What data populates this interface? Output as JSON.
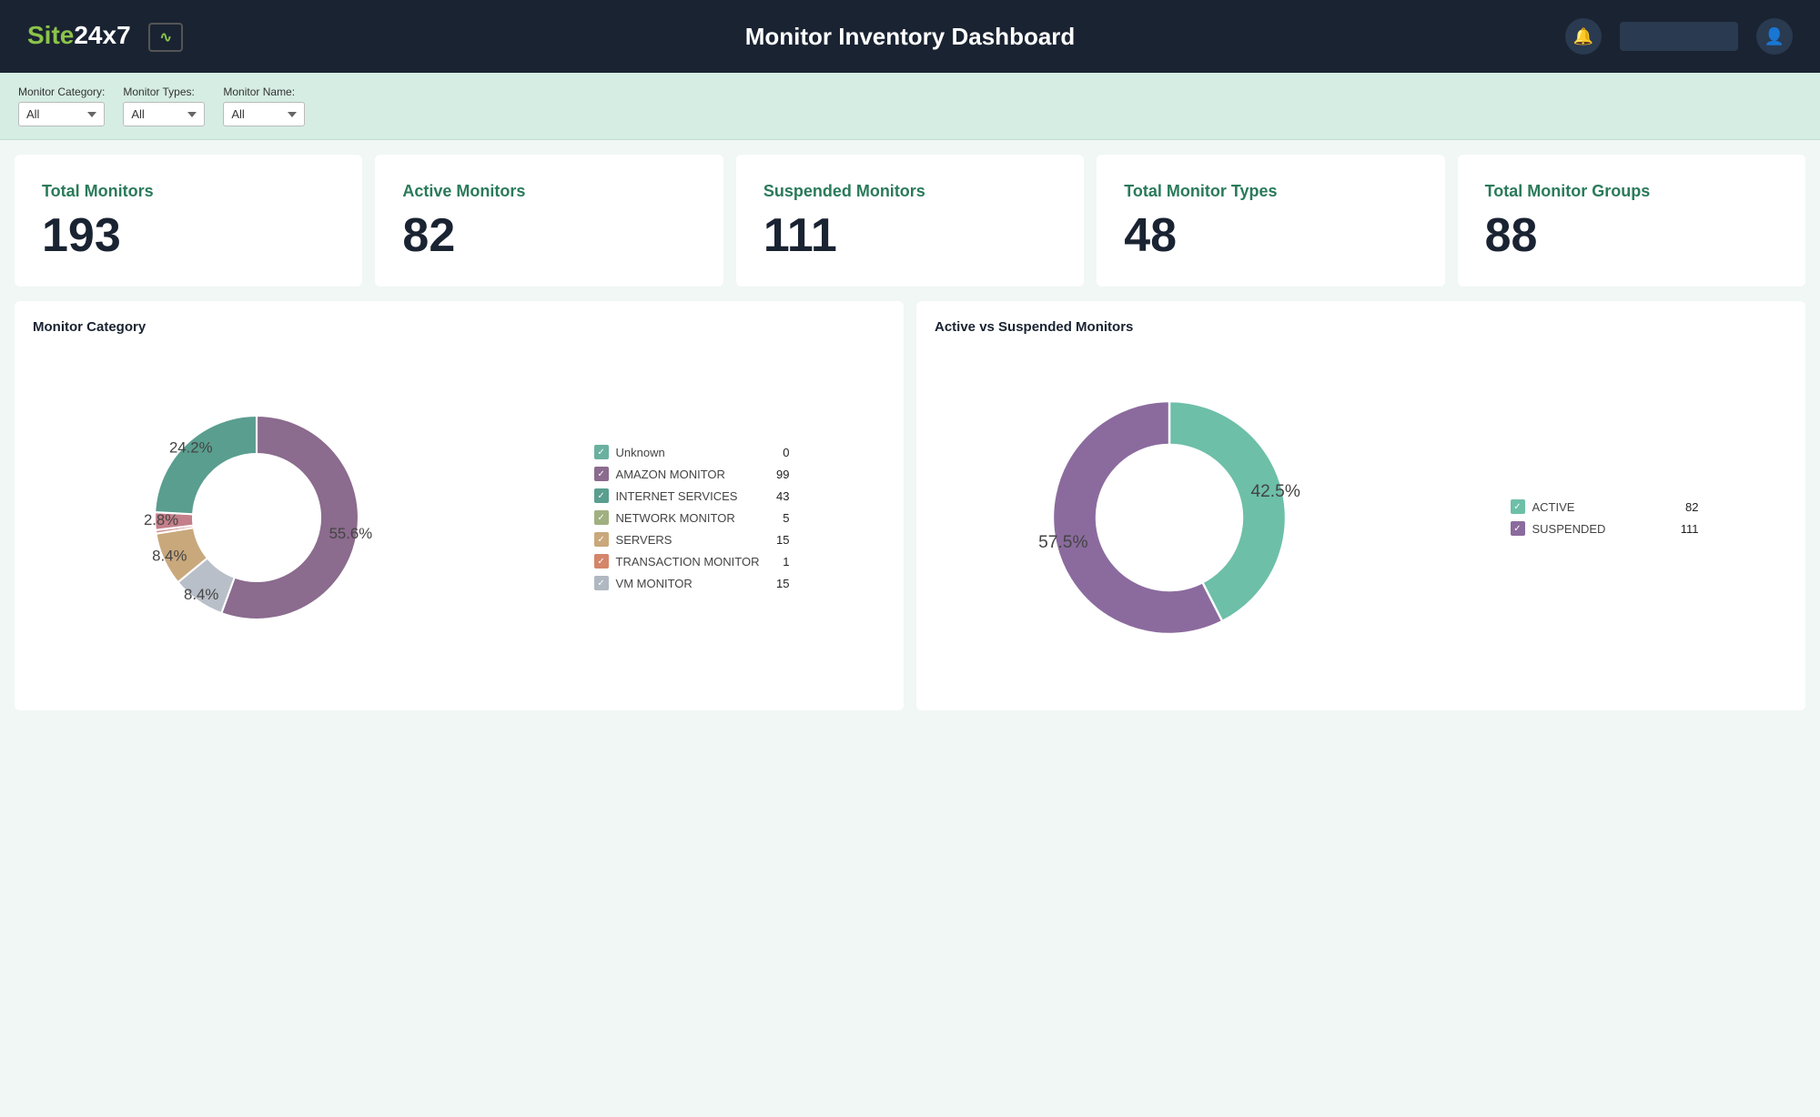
{
  "header": {
    "logo_site": "Site",
    "logo_num": "24x7",
    "title": "Monitor Inventory Dashboard",
    "icon_chart": "∿",
    "icon_bell": "🔔",
    "icon_user": "👤"
  },
  "filters": {
    "category_label": "Monitor Category:",
    "category_value": "All",
    "types_label": "Monitor Types:",
    "types_value": "All",
    "name_label": "Monitor Name:",
    "name_value": "All"
  },
  "stats": [
    {
      "title": "Total Monitors",
      "value": "193"
    },
    {
      "title": "Active Monitors",
      "value": "82"
    },
    {
      "title": "Suspended Monitors",
      "value": "111"
    },
    {
      "title": "Total Monitor Types",
      "value": "48"
    },
    {
      "title": "Total Monitor Groups",
      "value": "88"
    }
  ],
  "chart_category": {
    "title": "Monitor Category",
    "segments": [
      {
        "label": "AMAZON MONITOR",
        "value": 99,
        "pct": 55.6,
        "color": "#8b6b8e",
        "startAngle": 0
      },
      {
        "label": "VM MONITOR",
        "value": 15,
        "pct": 8.4,
        "color": "#b0b8c1",
        "startAngle": 200
      },
      {
        "label": "SERVERS",
        "value": 15,
        "pct": 8.4,
        "color": "#c9a87c",
        "startAngle": 230
      },
      {
        "label": "TRANSACTION MONITOR",
        "value": 1,
        "pct": 0.5,
        "color": "#d4a5a0",
        "startAngle": 260
      },
      {
        "label": "NETWORK MONITOR",
        "value": 5,
        "pct": 2.8,
        "color": "#c47f8a",
        "startAngle": 262
      },
      {
        "label": "INTERNET SERVICES",
        "value": 43,
        "pct": 24.2,
        "color": "#5a9e8f",
        "startAngle": 272
      },
      {
        "label": "Unknown",
        "value": 0,
        "pct": 0,
        "color": "#6ab0a0",
        "startAngle": 359
      }
    ],
    "legend": [
      {
        "label": "Unknown",
        "value": "0",
        "color": "#6ab0a0"
      },
      {
        "label": "AMAZON MONITOR",
        "value": "99",
        "color": "#8b6b8e"
      },
      {
        "label": "INTERNET SERVICES",
        "value": "43",
        "color": "#5a9e8f"
      },
      {
        "label": "NETWORK MONITOR",
        "value": "5",
        "color": "#a0b080"
      },
      {
        "label": "SERVERS",
        "value": "15",
        "color": "#c9a87c"
      },
      {
        "label": "TRANSACTION MONITOR",
        "value": "1",
        "color": "#d4856a"
      },
      {
        "label": "VM MONITOR",
        "value": "15",
        "color": "#b0b8c1"
      }
    ]
  },
  "chart_active_suspended": {
    "title": "Active vs Suspended Monitors",
    "segments": [
      {
        "label": "ACTIVE",
        "value": 82,
        "pct": 42.5,
        "color": "#6dbfa8"
      },
      {
        "label": "SUSPENDED",
        "value": 111,
        "pct": 57.5,
        "color": "#8b6b9e"
      }
    ],
    "legend": [
      {
        "label": "ACTIVE",
        "value": "82",
        "color": "#6dbfa8"
      },
      {
        "label": "SUSPENDED",
        "value": "111",
        "color": "#8b6b9e"
      }
    ],
    "pct_active": "42.5%",
    "pct_suspended": "57.5%"
  }
}
